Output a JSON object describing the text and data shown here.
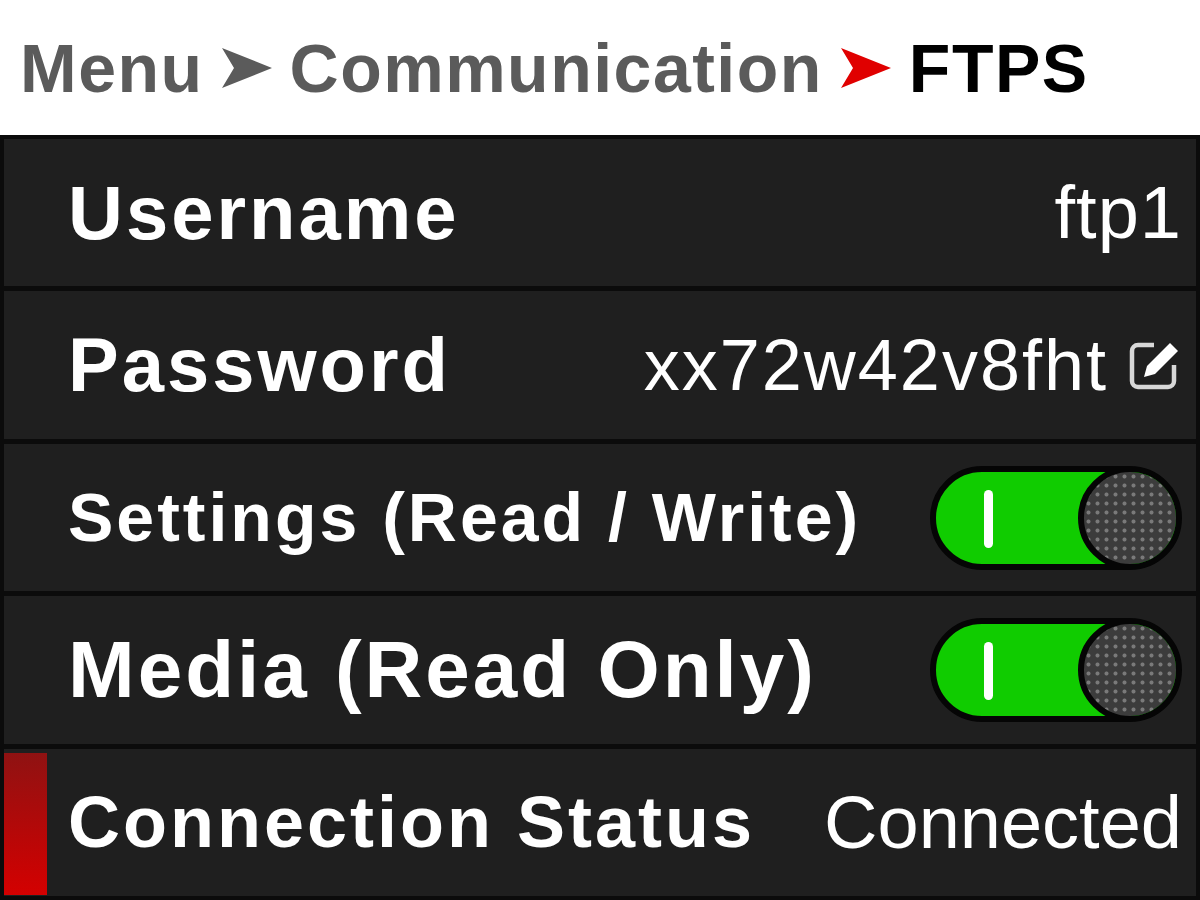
{
  "breadcrumb": [
    {
      "label": "Menu",
      "current": false
    },
    {
      "label": "Communication",
      "current": false
    },
    {
      "label": "FTPS",
      "current": true
    }
  ],
  "rows": [
    {
      "kind": "text",
      "label": "Username",
      "value": "ftp1",
      "selected": false
    },
    {
      "kind": "editable",
      "label": "Password",
      "value": "xx72w42v8fht",
      "selected": false
    },
    {
      "kind": "toggle",
      "label": "Settings (Read / Write)",
      "on": true,
      "selected": false
    },
    {
      "kind": "toggle",
      "label": "Media (Read Only)",
      "on": true,
      "selected": false
    },
    {
      "kind": "status",
      "label": "Connection Status",
      "value": "Connected",
      "selected": true
    }
  ]
}
